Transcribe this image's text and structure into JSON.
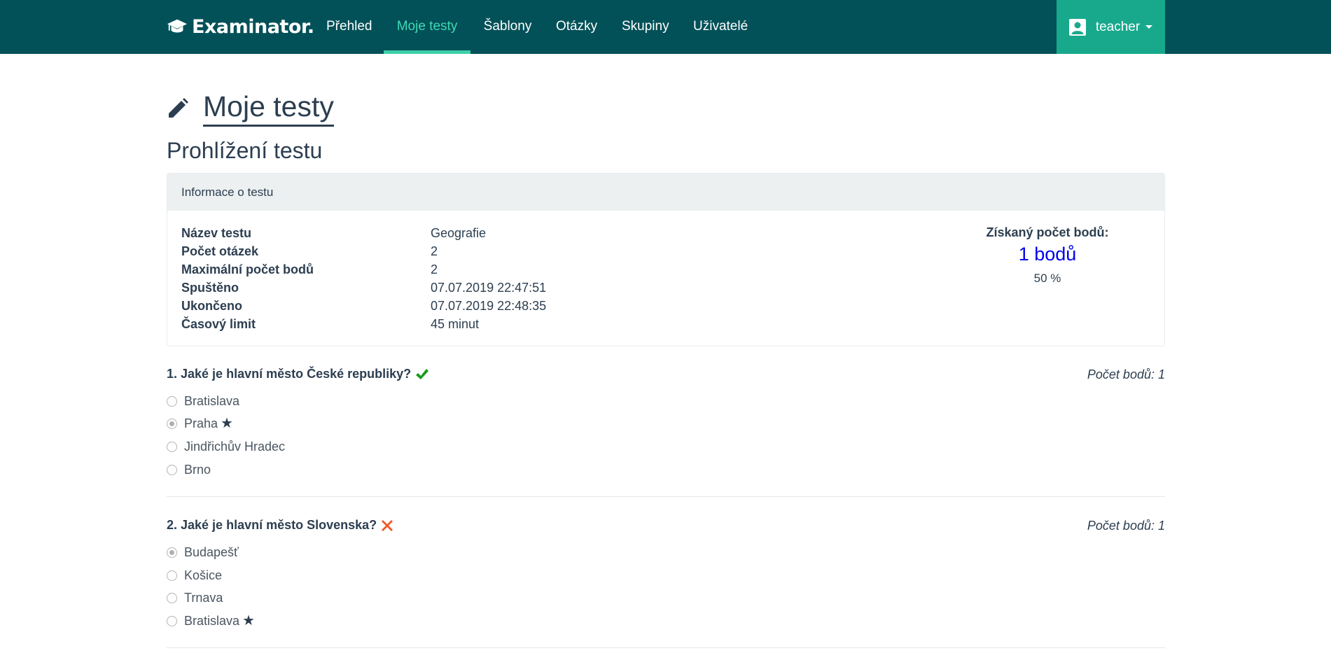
{
  "navbar": {
    "brand": "Examinator.",
    "items": [
      {
        "label": "Přehled"
      },
      {
        "label": "Moje testy"
      },
      {
        "label": "Šablony"
      },
      {
        "label": "Otázky"
      },
      {
        "label": "Skupiny"
      },
      {
        "label": "Uživatelé"
      }
    ],
    "active_index": 1,
    "user": "teacher"
  },
  "page": {
    "title": "Moje testy",
    "subtitle": "Prohlížení testu"
  },
  "info": {
    "header": "Informace o testu",
    "rows": [
      {
        "label": "Název testu",
        "value": "Geografie"
      },
      {
        "label": "Počet otázek",
        "value": "2"
      },
      {
        "label": "Maximální počet bodů",
        "value": "2"
      },
      {
        "label": "Spuštěno",
        "value": "07.07.2019 22:47:51"
      },
      {
        "label": "Ukončeno",
        "value": "07.07.2019 22:48:35"
      },
      {
        "label": "Časový limit",
        "value": "45 minut"
      }
    ],
    "score_label": "Získaný počet bodů:",
    "score_value": "1 bodů",
    "score_percent": "50 %"
  },
  "questions": [
    {
      "title": "1. Jaké je hlavní město České republiky?",
      "result": "correct",
      "points": "Počet bodů: 1",
      "options": [
        {
          "label": "Bratislava",
          "selected": false,
          "correct": false
        },
        {
          "label": "Praha",
          "selected": true,
          "correct": true
        },
        {
          "label": "Jindřichův Hradec",
          "selected": false,
          "correct": false
        },
        {
          "label": "Brno",
          "selected": false,
          "correct": false
        }
      ]
    },
    {
      "title": "2. Jaké je hlavní město Slovenska?",
      "result": "incorrect",
      "points": "Počet bodů: 1",
      "options": [
        {
          "label": "Budapešť",
          "selected": true,
          "correct": false
        },
        {
          "label": "Košice",
          "selected": false,
          "correct": false
        },
        {
          "label": "Trnava",
          "selected": false,
          "correct": false
        },
        {
          "label": "Bratislava",
          "selected": false,
          "correct": true
        }
      ]
    }
  ],
  "colors": {
    "navbar": "#025158",
    "active_link": "#3fd9b4",
    "user_box": "#18a98c",
    "correct": "#1a9a1a",
    "incorrect": "#f05a28",
    "score": "#0000ee"
  },
  "icons": {
    "brand": "graduation-cap-icon",
    "user": "user-icon",
    "page": "pencil-icon",
    "correct": "check-icon",
    "incorrect": "cross-icon",
    "correct_answer": "star-icon"
  }
}
